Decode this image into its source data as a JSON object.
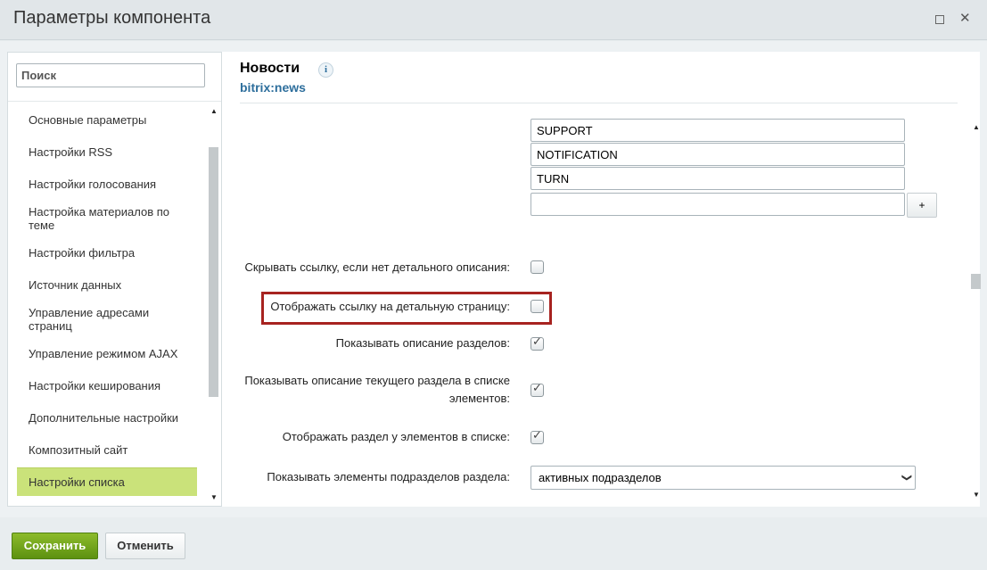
{
  "window": {
    "title": "Параметры компонента"
  },
  "sidebar": {
    "search_placeholder": "Поиск",
    "items": [
      {
        "label": "Основные параметры"
      },
      {
        "label": "Настройки RSS"
      },
      {
        "label": "Настройки голосования"
      },
      {
        "label": "Настройка материалов по теме"
      },
      {
        "label": "Настройки фильтра"
      },
      {
        "label": "Источник данных"
      },
      {
        "label": "Управление адресами страниц"
      },
      {
        "label": "Управление режимом AJAX"
      },
      {
        "label": "Настройки кеширования"
      },
      {
        "label": "Дополнительные настройки"
      },
      {
        "label": "Композитный сайт"
      },
      {
        "label": "Настройки списка"
      }
    ],
    "active_item": "Настройки списка"
  },
  "component": {
    "name": "Новости",
    "code": "bitrix:news",
    "info_icon": "i"
  },
  "params": {
    "list_values": [
      "SUPPORT",
      "NOTIFICATION",
      "TURN",
      ""
    ],
    "add_button": "+",
    "hide_link_label": "Скрывать ссылку, если нет детального описания:",
    "hide_link_checked": false,
    "show_detail_link_label": "Отображать ссылку на детальную страницу:",
    "show_detail_link_checked": false,
    "show_section_desc_label": "Показывать описание разделов:",
    "show_section_desc_checked": true,
    "show_current_section_desc_label_1": "Показывать описание текущего раздела в списке",
    "show_current_section_desc_label_2": "элементов:",
    "show_current_section_desc_checked": true,
    "show_section_in_list_label": "Отображать раздел у элементов в списке:",
    "show_section_in_list_checked": true,
    "subsections_label": "Показывать элементы подразделов раздела:",
    "subsections_value": "активных подразделов"
  },
  "footer": {
    "save_label": "Сохранить",
    "cancel_label": "Отменить"
  },
  "colors": {
    "accent_green": "#6ea21b",
    "active_item": "#cae27a",
    "highlight_border": "#a72320",
    "link_blue": "#2d6e9c"
  }
}
